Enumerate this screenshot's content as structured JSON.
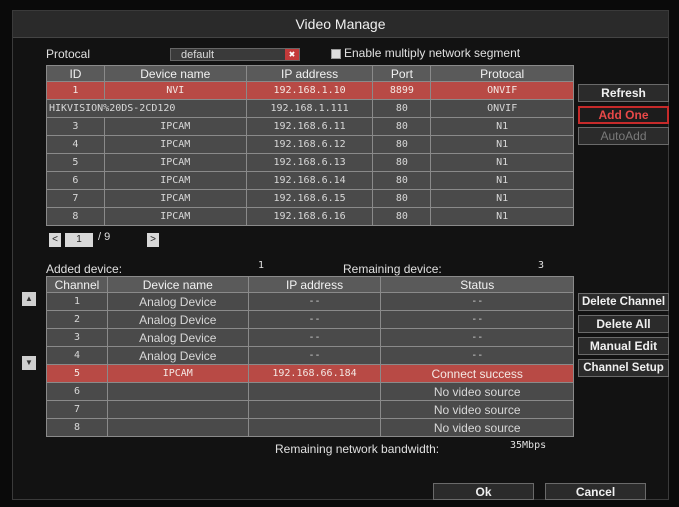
{
  "window": {
    "title": "Video Manage"
  },
  "top": {
    "protocol_label": "Protocal",
    "protocol_value": "default",
    "multi_segment_label": "Enable multiply network segment"
  },
  "search_table": {
    "headers": [
      "ID",
      "Device name",
      "IP address",
      "Port",
      "Protocal"
    ],
    "rows": [
      [
        "1",
        "NVI",
        "192.168.1.10",
        "8899",
        "ONVIF"
      ],
      [
        "HIKVISION%20DS-2CD120",
        "",
        "192.168.1.111",
        "80",
        "ONVIF"
      ],
      [
        "3",
        "IPCAM",
        "192.168.6.11",
        "80",
        "N1"
      ],
      [
        "4",
        "IPCAM",
        "192.168.6.12",
        "80",
        "N1"
      ],
      [
        "5",
        "IPCAM",
        "192.168.6.13",
        "80",
        "N1"
      ],
      [
        "6",
        "IPCAM",
        "192.168.6.14",
        "80",
        "N1"
      ],
      [
        "7",
        "IPCAM",
        "192.168.6.15",
        "80",
        "N1"
      ],
      [
        "8",
        "IPCAM",
        "192.168.6.16",
        "80",
        "N1"
      ]
    ]
  },
  "pager": {
    "prev": "<",
    "current": "1",
    "sep_total": "/ 9",
    "next": ">"
  },
  "right_buttons_top": {
    "refresh": "Refresh",
    "add_one": "Add One",
    "auto_add": "AutoAdd"
  },
  "added": {
    "added_label": "Added device:",
    "added_count": "1",
    "remaining_label": "Remaining device:",
    "remaining_count": "3"
  },
  "channel_table": {
    "headers": [
      "Channel",
      "Device name",
      "IP address",
      "Status"
    ],
    "rows": [
      [
        "1",
        "Analog Device",
        "--",
        "--"
      ],
      [
        "2",
        "Analog Device",
        "--",
        "--"
      ],
      [
        "3",
        "Analog Device",
        "--",
        "--"
      ],
      [
        "4",
        "Analog Device",
        "--",
        "--"
      ],
      [
        "5",
        "IPCAM",
        "192.168.66.184",
        "Connect success"
      ],
      [
        "6",
        "",
        "",
        "No video source"
      ],
      [
        "7",
        "",
        "",
        "No video source"
      ],
      [
        "8",
        "",
        "",
        "No video source"
      ]
    ]
  },
  "right_buttons_bottom": {
    "delete_channel": "Delete Channel",
    "delete_all": "Delete All",
    "manual_edit": "Manual Edit",
    "channel_setup": "Channel Setup"
  },
  "bandwidth": {
    "label": "Remaining network bandwidth:",
    "value": "35Mbps"
  },
  "footer": {
    "ok": "Ok",
    "cancel": "Cancel"
  },
  "side_arrows": {
    "up": "▲",
    "down": "▼"
  },
  "colors": {
    "selected_row": "#b84a45",
    "add_one_border": "#c62a2a"
  }
}
